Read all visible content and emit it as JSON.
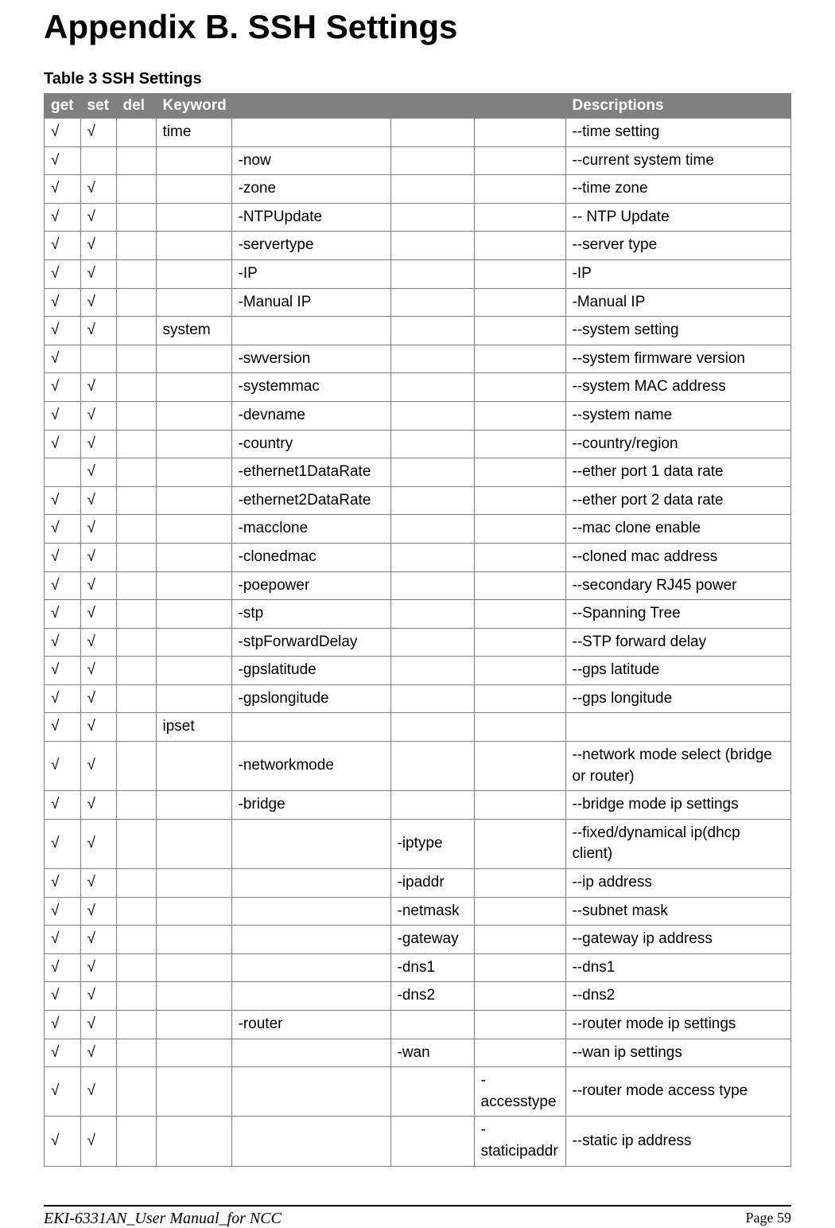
{
  "title": "Appendix B. SSH Settings",
  "tableCaption": "Table 3 SSH Settings",
  "headers": {
    "get": "get",
    "set": "set",
    "del": "del",
    "keyword": "Keyword",
    "descriptions": "Descriptions"
  },
  "check": "√",
  "rows": [
    {
      "get": true,
      "set": true,
      "del": false,
      "k1": "time",
      "k2": "",
      "k3": "",
      "k4": "",
      "desc": "--time setting"
    },
    {
      "get": true,
      "set": false,
      "del": false,
      "k1": "",
      "k2": "-now",
      "k3": "",
      "k4": "",
      "desc": "--current system time"
    },
    {
      "get": true,
      "set": true,
      "del": false,
      "k1": "",
      "k2": "-zone",
      "k3": "",
      "k4": "",
      "desc": "--time zone"
    },
    {
      "get": true,
      "set": true,
      "del": false,
      "k1": "",
      "k2": "-NTPUpdate",
      "k3": "",
      "k4": "",
      "desc": "-- NTP Update"
    },
    {
      "get": true,
      "set": true,
      "del": false,
      "k1": "",
      "k2": "-servertype",
      "k3": "",
      "k4": "",
      "desc": "--server type"
    },
    {
      "get": true,
      "set": true,
      "del": false,
      "k1": "",
      "k2": "-IP",
      "k3": "",
      "k4": "",
      "desc": "-IP"
    },
    {
      "get": true,
      "set": true,
      "del": false,
      "k1": "",
      "k2": "-Manual IP",
      "k3": "",
      "k4": "",
      "desc": "-Manual IP"
    },
    {
      "get": true,
      "set": true,
      "del": false,
      "k1": "system",
      "k2": "",
      "k3": "",
      "k4": "",
      "desc": "--system setting"
    },
    {
      "get": true,
      "set": false,
      "del": false,
      "k1": "",
      "k2": "-swversion",
      "k3": "",
      "k4": "",
      "desc": "--system firmware version"
    },
    {
      "get": true,
      "set": true,
      "del": false,
      "k1": "",
      "k2": "-systemmac",
      "k3": "",
      "k4": "",
      "desc": "--system MAC address"
    },
    {
      "get": true,
      "set": true,
      "del": false,
      "k1": "",
      "k2": "-devname",
      "k3": "",
      "k4": "",
      "desc": "--system name"
    },
    {
      "get": true,
      "set": true,
      "del": false,
      "k1": "",
      "k2": "-country",
      "k3": "",
      "k4": "",
      "desc": "--country/region"
    },
    {
      "get": false,
      "set": true,
      "del": false,
      "k1": "",
      "k2": "-ethernet1DataRate",
      "k3": "",
      "k4": "",
      "desc": "--ether port 1 data rate"
    },
    {
      "get": true,
      "set": true,
      "del": false,
      "k1": "",
      "k2": "-ethernet2DataRate",
      "k3": "",
      "k4": "",
      "desc": "--ether port 2 data rate"
    },
    {
      "get": true,
      "set": true,
      "del": false,
      "k1": "",
      "k2": "-macclone",
      "k3": "",
      "k4": "",
      "desc": "--mac clone enable"
    },
    {
      "get": true,
      "set": true,
      "del": false,
      "k1": "",
      "k2": "-clonedmac",
      "k3": "",
      "k4": "",
      "desc": "--cloned mac address"
    },
    {
      "get": true,
      "set": true,
      "del": false,
      "k1": "",
      "k2": "-poepower",
      "k3": "",
      "k4": "",
      "desc": "--secondary RJ45 power"
    },
    {
      "get": true,
      "set": true,
      "del": false,
      "k1": "",
      "k2": "-stp",
      "k3": "",
      "k4": "",
      "desc": "--Spanning Tree"
    },
    {
      "get": true,
      "set": true,
      "del": false,
      "k1": "",
      "k2": "-stpForwardDelay",
      "k3": "",
      "k4": "",
      "desc": "--STP forward delay"
    },
    {
      "get": true,
      "set": true,
      "del": false,
      "k1": "",
      "k2": "-gpslatitude",
      "k3": "",
      "k4": "",
      "desc": "--gps latitude"
    },
    {
      "get": true,
      "set": true,
      "del": false,
      "k1": "",
      "k2": "-gpslongitude",
      "k3": "",
      "k4": "",
      "desc": "--gps longitude"
    },
    {
      "get": true,
      "set": true,
      "del": false,
      "k1": "ipset",
      "k2": "",
      "k3": "",
      "k4": "",
      "desc": ""
    },
    {
      "get": true,
      "set": true,
      "del": false,
      "k1": "",
      "k2": "-networkmode",
      "k3": "",
      "k4": "",
      "desc": "--network mode select (bridge or router)"
    },
    {
      "get": true,
      "set": true,
      "del": false,
      "k1": "",
      "k2": "-bridge",
      "k3": "",
      "k4": "",
      "desc": "--bridge mode ip settings"
    },
    {
      "get": true,
      "set": true,
      "del": false,
      "k1": "",
      "k2": "",
      "k3": "-iptype",
      "k4": "",
      "desc": "--fixed/dynamical ip(dhcp client)"
    },
    {
      "get": true,
      "set": true,
      "del": false,
      "k1": "",
      "k2": "",
      "k3": "-ipaddr",
      "k4": "",
      "desc": "--ip address"
    },
    {
      "get": true,
      "set": true,
      "del": false,
      "k1": "",
      "k2": "",
      "k3": "-netmask",
      "k4": "",
      "desc": "--subnet mask"
    },
    {
      "get": true,
      "set": true,
      "del": false,
      "k1": "",
      "k2": "",
      "k3": "-gateway",
      "k4": "",
      "desc": "--gateway ip address"
    },
    {
      "get": true,
      "set": true,
      "del": false,
      "k1": "",
      "k2": "",
      "k3": "-dns1",
      "k4": "",
      "desc": "--dns1"
    },
    {
      "get": true,
      "set": true,
      "del": false,
      "k1": "",
      "k2": "",
      "k3": "-dns2",
      "k4": "",
      "desc": "--dns2"
    },
    {
      "get": true,
      "set": true,
      "del": false,
      "k1": "",
      "k2": "-router",
      "k3": "",
      "k4": "",
      "desc": "--router mode ip settings"
    },
    {
      "get": true,
      "set": true,
      "del": false,
      "k1": "",
      "k2": "",
      "k3": "-wan",
      "k4": "",
      "desc": "--wan ip settings"
    },
    {
      "get": true,
      "set": true,
      "del": false,
      "k1": "",
      "k2": "",
      "k3": "",
      "k4": "-accesstype",
      "desc": "--router mode access type"
    },
    {
      "get": true,
      "set": true,
      "del": false,
      "k1": "",
      "k2": "",
      "k3": "",
      "k4": "-staticipaddr",
      "desc": "--static ip address"
    }
  ],
  "footer": {
    "left": "EKI-6331AN_User Manual_for NCC",
    "right": "Page 59"
  }
}
